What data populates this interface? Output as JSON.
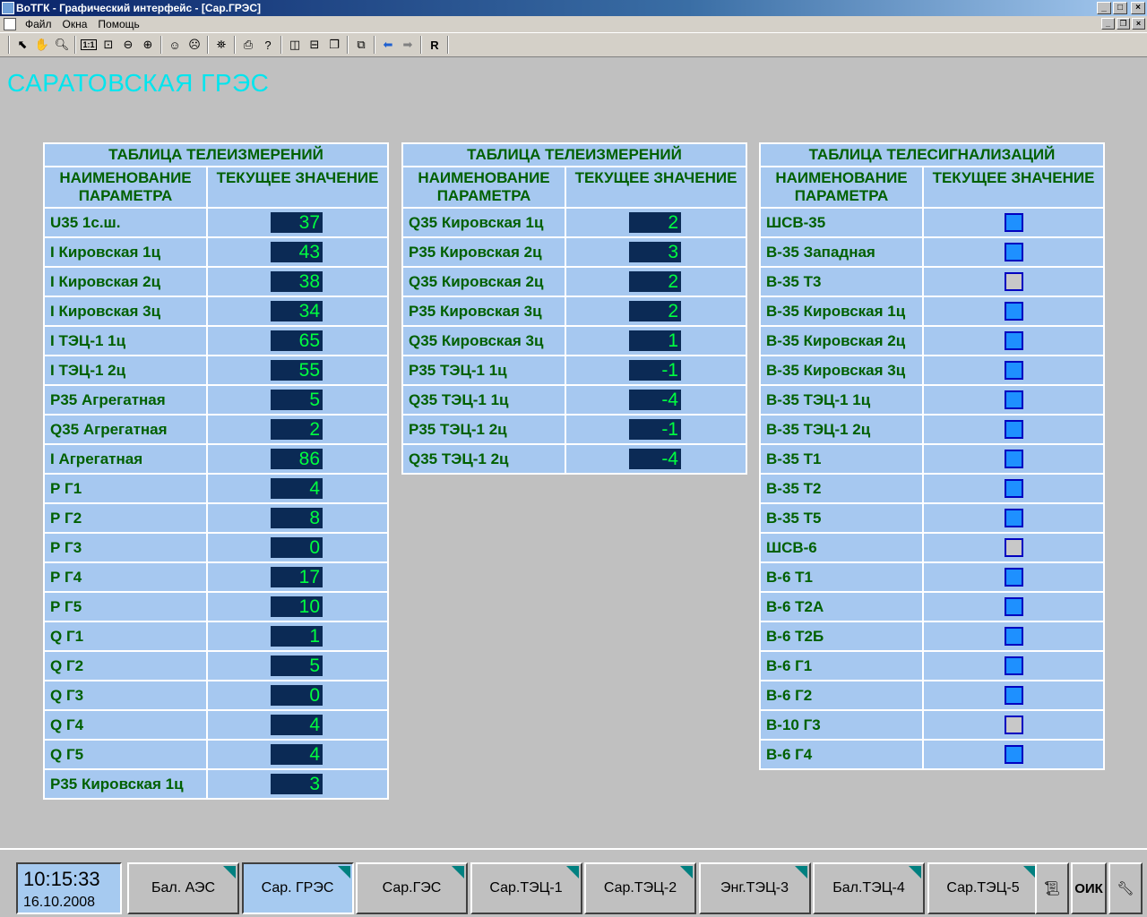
{
  "window": {
    "title": "ВоТГК - Графический интерфейс - [Сар.ГРЭС]"
  },
  "menu": {
    "items": [
      "Файл",
      "Окна",
      "Помощь"
    ]
  },
  "toolbar": {
    "r_label": "R",
    "ratio_label": "1:1"
  },
  "station_title": "САРАТОВСКАЯ ГРЭС",
  "tables": [
    {
      "title": "ТАБЛИЦА ТЕЛЕИЗМЕРЕНИЙ",
      "col1": "НАИМЕНОВАНИЕ ПАРАМЕТРА",
      "col2": "ТЕКУЩЕЕ ЗНАЧЕНИЕ",
      "rows": [
        {
          "name": "U35 1с.ш.",
          "value": "37"
        },
        {
          "name": "I Кировская 1ц",
          "value": "43"
        },
        {
          "name": "I Кировская 2ц",
          "value": "38"
        },
        {
          "name": "I Кировская 3ц",
          "value": "34"
        },
        {
          "name": "I ТЭЦ-1 1ц",
          "value": "65"
        },
        {
          "name": "I ТЭЦ-1 2ц",
          "value": "55"
        },
        {
          "name": "P35 Агрегатная",
          "value": "5"
        },
        {
          "name": "Q35 Агрегатная",
          "value": "2"
        },
        {
          "name": "I Агрегатная",
          "value": "86"
        },
        {
          "name": "Р Г1",
          "value": "4"
        },
        {
          "name": "Р Г2",
          "value": "8"
        },
        {
          "name": "Р Г3",
          "value": "0"
        },
        {
          "name": "Р Г4",
          "value": "17"
        },
        {
          "name": "Р Г5",
          "value": "10"
        },
        {
          "name": "Q Г1",
          "value": "1"
        },
        {
          "name": "Q Г2",
          "value": "5"
        },
        {
          "name": "Q Г3",
          "value": "0"
        },
        {
          "name": "Q Г4",
          "value": "4"
        },
        {
          "name": "Q Г5",
          "value": "4"
        },
        {
          "name": "P35 Кировская 1ц",
          "value": "3"
        }
      ]
    },
    {
      "title": "ТАБЛИЦА ТЕЛЕИЗМЕРЕНИЙ",
      "col1": "НАИМЕНОВАНИЕ ПАРАМЕТРА",
      "col2": "ТЕКУЩЕЕ ЗНАЧЕНИЕ",
      "rows": [
        {
          "name": "Q35 Кировская 1ц",
          "value": "2"
        },
        {
          "name": "P35 Кировская 2ц",
          "value": "3"
        },
        {
          "name": "Q35 Кировская 2ц",
          "value": "2"
        },
        {
          "name": "P35 Кировская 3ц",
          "value": "2"
        },
        {
          "name": "Q35 Кировская 3ц",
          "value": "1"
        },
        {
          "name": "P35 ТЭЦ-1 1ц",
          "value": "-1"
        },
        {
          "name": "Q35 ТЭЦ-1 1ц",
          "value": "-4"
        },
        {
          "name": "P35 ТЭЦ-1 2ц",
          "value": "-1"
        },
        {
          "name": "Q35 ТЭЦ-1 2ц",
          "value": "-4"
        }
      ]
    }
  ],
  "signals": {
    "title": "ТАБЛИЦА ТЕЛЕСИГНАЛИЗАЦИЙ",
    "col1": "НАИМЕНОВАНИЕ ПАРАМЕТРА",
    "col2": "ТЕКУЩЕЕ ЗНАЧЕНИЕ",
    "rows": [
      {
        "name": "ШСВ-35",
        "state": "on"
      },
      {
        "name": "В-35 Западная",
        "state": "on"
      },
      {
        "name": "В-35 Т3",
        "state": "off"
      },
      {
        "name": "В-35 Кировская 1ц",
        "state": "on"
      },
      {
        "name": "В-35 Кировская 2ц",
        "state": "on"
      },
      {
        "name": "В-35 Кировская 3ц",
        "state": "on"
      },
      {
        "name": "В-35 ТЭЦ-1 1ц",
        "state": "on"
      },
      {
        "name": "В-35 ТЭЦ-1 2ц",
        "state": "on"
      },
      {
        "name": "В-35 Т1",
        "state": "on"
      },
      {
        "name": "В-35 Т2",
        "state": "on"
      },
      {
        "name": "В-35 Т5",
        "state": "on"
      },
      {
        "name": "ШСВ-6",
        "state": "off"
      },
      {
        "name": "В-6 Т1",
        "state": "on"
      },
      {
        "name": "В-6 Т2А",
        "state": "on"
      },
      {
        "name": "В-6 Т2Б",
        "state": "on"
      },
      {
        "name": "В-6 Г1",
        "state": "on"
      },
      {
        "name": "В-6 Г2",
        "state": "on"
      },
      {
        "name": "В-10 Г3",
        "state": "off"
      },
      {
        "name": "В-6 Г4",
        "state": "on"
      }
    ]
  },
  "status": {
    "time": "10:15:33",
    "date": "16.10.2008"
  },
  "tabs": [
    "Бал. АЭС",
    "Сар. ГРЭС",
    "Сар.ГЭС",
    "Сар.ТЭЦ-1",
    "Сар.ТЭЦ-2",
    "Энг.ТЭЦ-3",
    "Бал.ТЭЦ-4",
    "Сар.ТЭЦ-5"
  ],
  "active_tab": "Сар. ГРЭС",
  "bottom_buttons": {
    "oik_label": "ОИК"
  },
  "colors": {
    "title": "#00e5ee",
    "cell": "#a6c8f0",
    "value_bg": "#0b2a55",
    "value_fg": "#00ff40",
    "signal_on": "#1e90ff",
    "signal_off": "#c8c8c8"
  }
}
